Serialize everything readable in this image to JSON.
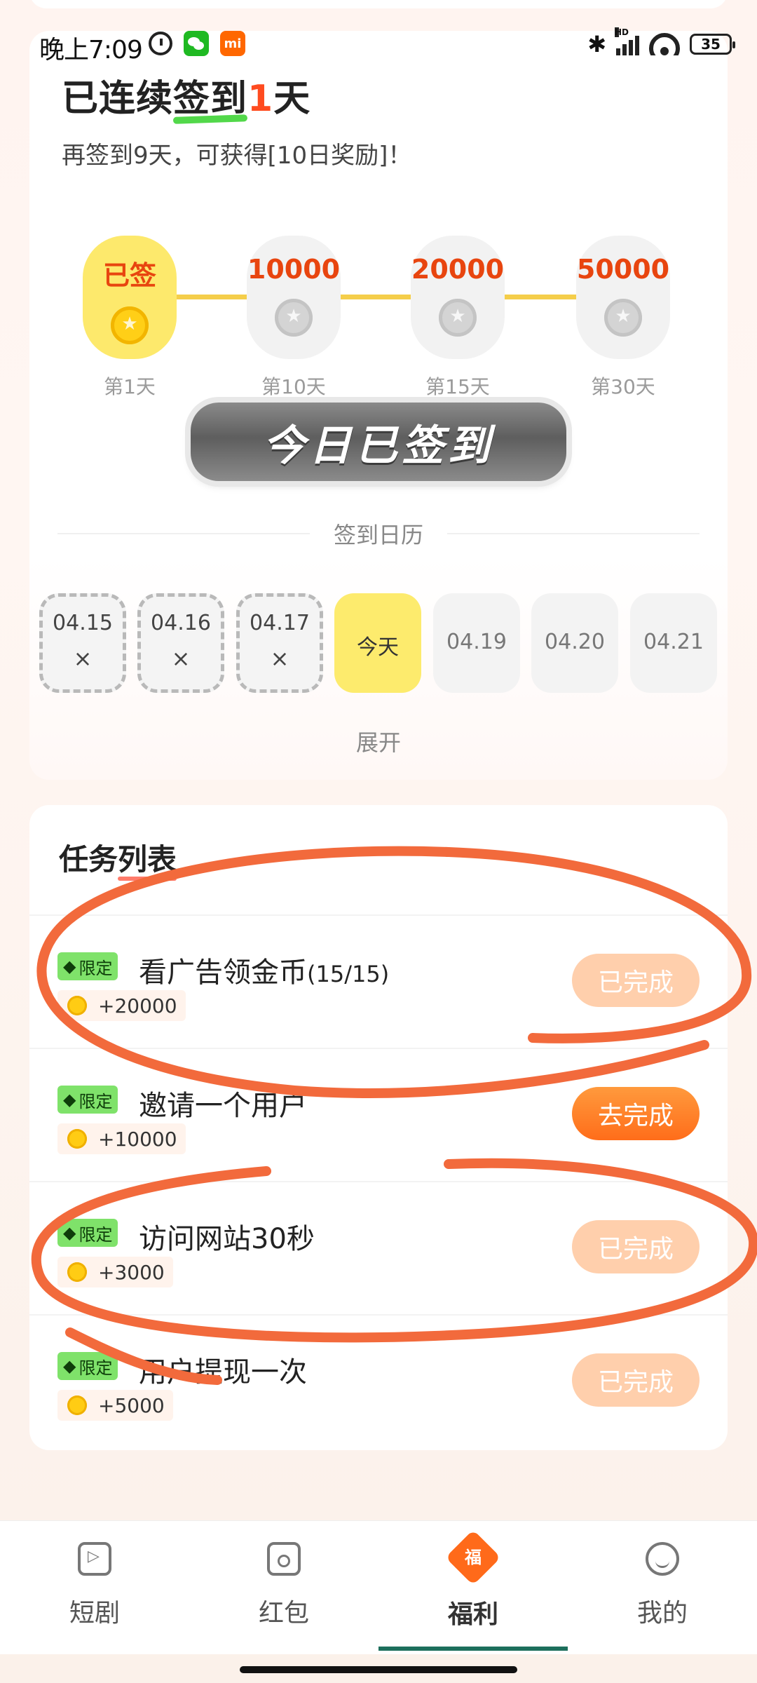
{
  "status_bar": {
    "time": "晚上7:09",
    "battery": "35",
    "hd_label": "HD",
    "mi_label": "mi"
  },
  "checkin": {
    "title_prefix": "已连续",
    "title_hl": "签到",
    "title_num": "1",
    "title_suffix": "天",
    "subtitle": "再签到9天，可获得[10日奖励]！",
    "milestones": [
      {
        "value": "已签",
        "day": "第1天",
        "active": true
      },
      {
        "value": "10000",
        "day": "第10天",
        "active": false
      },
      {
        "value": "20000",
        "day": "第15天",
        "active": false
      },
      {
        "value": "50000",
        "day": "第30天",
        "active": false
      }
    ],
    "checked_button": "今日已签到",
    "calendar_title": "签到日历",
    "calendar": [
      {
        "date": "04.15",
        "mark": "×",
        "state": "missed"
      },
      {
        "date": "04.16",
        "mark": "×",
        "state": "missed"
      },
      {
        "date": "04.17",
        "mark": "×",
        "state": "missed"
      },
      {
        "date": "今天",
        "mark": "",
        "state": "today"
      },
      {
        "date": "04.19",
        "mark": "",
        "state": "future"
      },
      {
        "date": "04.20",
        "mark": "",
        "state": "future"
      },
      {
        "date": "04.21",
        "mark": "",
        "state": "future"
      }
    ],
    "expand_label": "展开"
  },
  "tasks": {
    "title_a": "任务",
    "title_b": "列表",
    "items": [
      {
        "badge": "限定",
        "name": "看广告领金币",
        "extra": "(15/15)",
        "reward": "+20000",
        "action": "已完成",
        "state": "done"
      },
      {
        "badge": "限定",
        "name": "邀请一个用户",
        "extra": "",
        "reward": "+10000",
        "action": "去完成",
        "state": "go"
      },
      {
        "badge": "限定",
        "name": "访问网站30秒",
        "extra": "",
        "reward": "+3000",
        "action": "已完成",
        "state": "done"
      },
      {
        "badge": "限定",
        "name": "用户提现一次",
        "extra": "",
        "reward": "+5000",
        "action": "已完成",
        "state": "done"
      }
    ]
  },
  "nav": {
    "items": [
      {
        "label": "短剧",
        "icon": "play-icon"
      },
      {
        "label": "红包",
        "icon": "red-packet-icon"
      },
      {
        "label": "福利",
        "icon": "welfare-icon",
        "icon_text": "福",
        "active": true
      },
      {
        "label": "我的",
        "icon": "profile-icon"
      }
    ]
  },
  "colors": {
    "accent": "#ff6d1a",
    "done_button": "#ffcfac",
    "badge_green": "#7fe26a",
    "annotation": "#f26a3c",
    "active_milestone": "#fde96c"
  }
}
